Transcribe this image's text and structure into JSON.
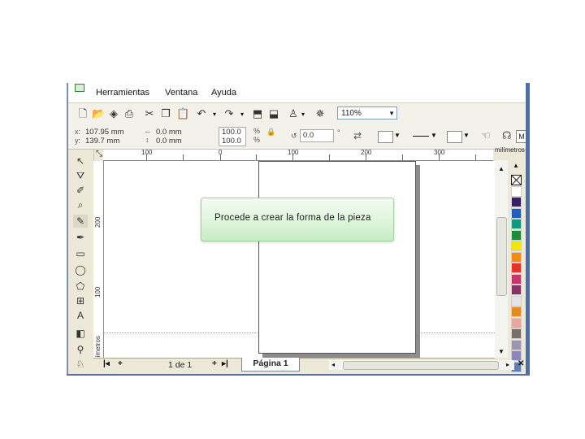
{
  "menu": {
    "items": [
      "Herramientas",
      "Ventana",
      "Ayuda"
    ]
  },
  "toolbar": {
    "zoom_value": "110%"
  },
  "property_bar": {
    "x_label": "x:",
    "y_label": "y:",
    "x_value": "107.95 mm",
    "y_value": "139.7 mm",
    "width_value": "0.0 mm",
    "height_value": "0.0 mm",
    "scale_x": "100.0",
    "scale_y": "100.0",
    "percent_x": "%",
    "percent_y": "%",
    "rotation_value": "0.0",
    "degree_symbol": "°"
  },
  "ruler": {
    "top_labels": [
      "100",
      "0",
      "100",
      "200",
      "300"
    ],
    "left_labels": [
      "200",
      "100"
    ],
    "units": "milímetros",
    "units_vertical": "milímetros"
  },
  "callout": {
    "text": "Procede a crear la forma de la pieza"
  },
  "page_nav": {
    "count": "1 de 1",
    "tab_label": "Página 1"
  },
  "palette": {
    "colors": [
      "#ffffff",
      "#ffffff",
      "#3b1f66",
      "#1f5fbf",
      "#0f9a7f",
      "#1e8c3a",
      "#f2e600",
      "#f38a16",
      "#e4332a",
      "#c7356e",
      "#8b2f6b",
      "#e4e4e4",
      "#e38b21",
      "#e8a6a1",
      "#7a6e6a",
      "#9e94b3",
      "#8888b8",
      "#5e7eb6"
    ]
  }
}
